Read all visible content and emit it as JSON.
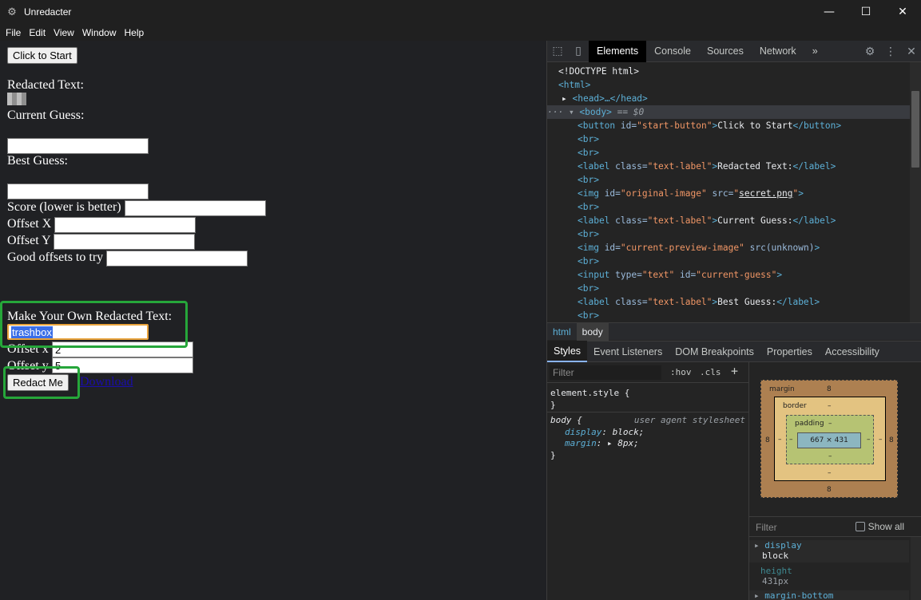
{
  "window": {
    "title": "Unredacter",
    "controls": {
      "minimize": "—",
      "maximize": "☐",
      "close": "✕"
    }
  },
  "menu": [
    "File",
    "Edit",
    "View",
    "Window",
    "Help"
  ],
  "page": {
    "start_button": "Click to Start",
    "redacted_label": "Redacted Text:",
    "current_guess_label": "Current Guess:",
    "best_guess_label": "Best Guess:",
    "score_label": "Score (lower is better)",
    "offset_x_label": "Offset X",
    "offset_y_label": "Offset Y",
    "good_offsets_label": "Good offsets to try",
    "make_own_label": "Make Your Own Redacted Text:",
    "own_text_value": "trashbox",
    "own_offset_x_label": "Offset x",
    "own_offset_x_value": "2",
    "own_offset_y_label": "Offset y",
    "own_offset_y_value": "5",
    "redact_button": "Redact Me",
    "download_link": "Download"
  },
  "devtools": {
    "tabs": [
      "Elements",
      "Console",
      "Sources",
      "Network"
    ],
    "more_tabs": "»",
    "dom": {
      "doctype": "<!DOCTYPE html>",
      "html_open": "<html>",
      "head_collapsed": "<head>…</head>",
      "body_open": "<body>",
      "body_marker": "== $0",
      "start_button_id": "start-button",
      "start_button_text": "Click to Start",
      "redacted_label_text": "Redacted Text:",
      "original_image_id": "original-image",
      "original_image_src": "secret.png",
      "current_guess_label_text": "Current Guess:",
      "preview_image_id": "current-preview-image",
      "preview_image_src": "src(unknown)",
      "input_type": "text",
      "input_id": "current-guess",
      "best_guess_label_text": "Best Guess:"
    },
    "breadcrumbs": [
      "html",
      "body"
    ],
    "subtabs": [
      "Styles",
      "Event Listeners",
      "DOM Breakpoints",
      "Properties",
      "Accessibility"
    ],
    "styles": {
      "filter_placeholder": "Filter",
      "hov": ":hov",
      "cls": ".cls",
      "add": "+",
      "element_style": "element.style {",
      "close_brace": "}",
      "body_selector": "body {",
      "ua": "user agent stylesheet",
      "rules": [
        {
          "prop": "display",
          "value": "block;"
        },
        {
          "prop": "margin",
          "value": "8px;"
        }
      ]
    },
    "box_model": {
      "margin_label": "margin",
      "margin_value": "8",
      "border_label": "border",
      "border_value": "–",
      "padding_label": "padding",
      "padding_value": "–",
      "content": "667 × 431",
      "side_margin": "8",
      "side_dash": "–"
    },
    "computed": {
      "filter_placeholder": "Filter",
      "show_all": "Show all",
      "rows": [
        {
          "prop": "display",
          "value": "block"
        },
        {
          "prop": "height",
          "value": "431px"
        },
        {
          "prop": "margin-bottom",
          "value": ""
        }
      ]
    }
  }
}
